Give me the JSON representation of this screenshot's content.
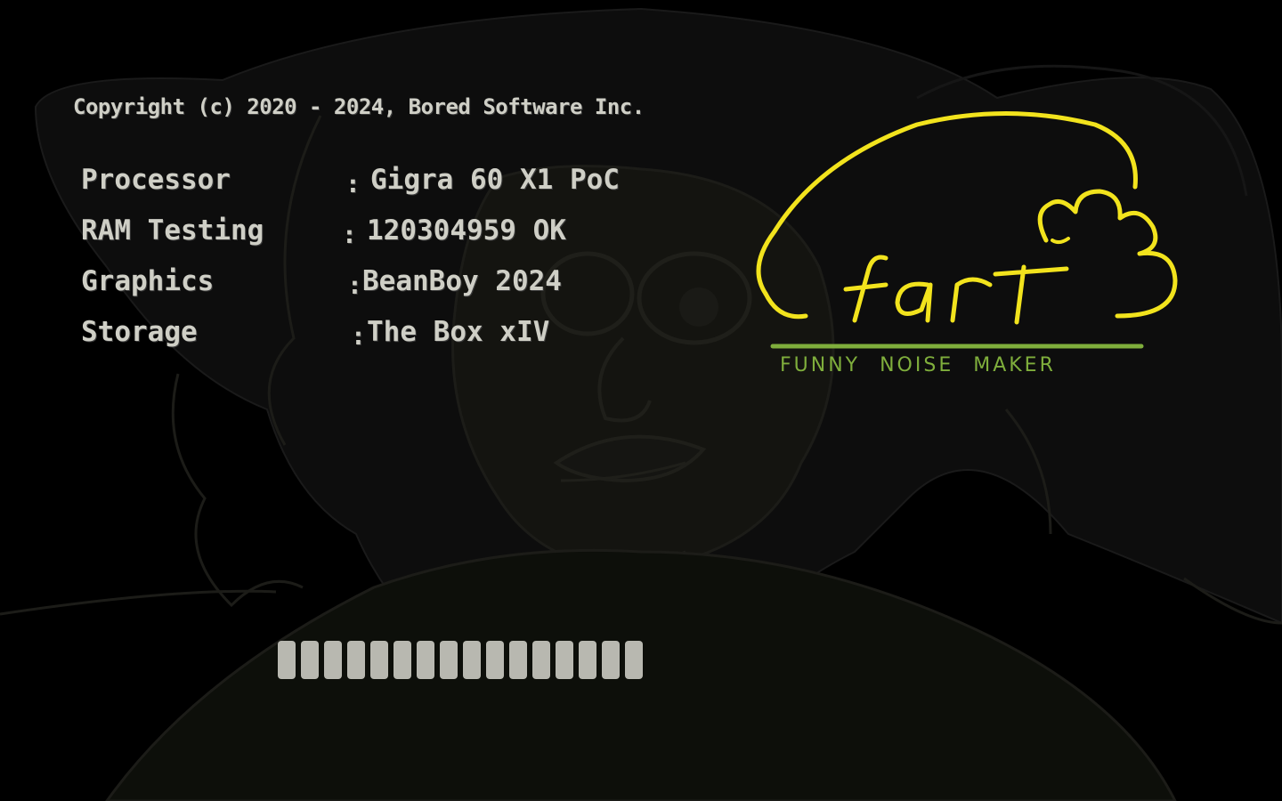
{
  "copyright": "Copyright (c) 2020 - 2024, Bored Software Inc.",
  "specs": [
    {
      "label": "Processor",
      "separator": ":",
      "value": "Gigra 60 X1 PoC"
    },
    {
      "label": "RAM Testing",
      "separator": ":",
      "value": "120304959 OK"
    },
    {
      "label": "Graphics",
      "separator": ":",
      "value": "BeanBoy 2024"
    },
    {
      "label": "Storage",
      "separator": ":",
      "value": "The Box xIV"
    }
  ],
  "loading": {
    "progress": 0.6
  },
  "logo": {
    "name": "fart",
    "tagline": "FUNNY NOISE MAKER",
    "colors": {
      "primary": "#f2e31d",
      "accent": "#7fae3c"
    }
  }
}
